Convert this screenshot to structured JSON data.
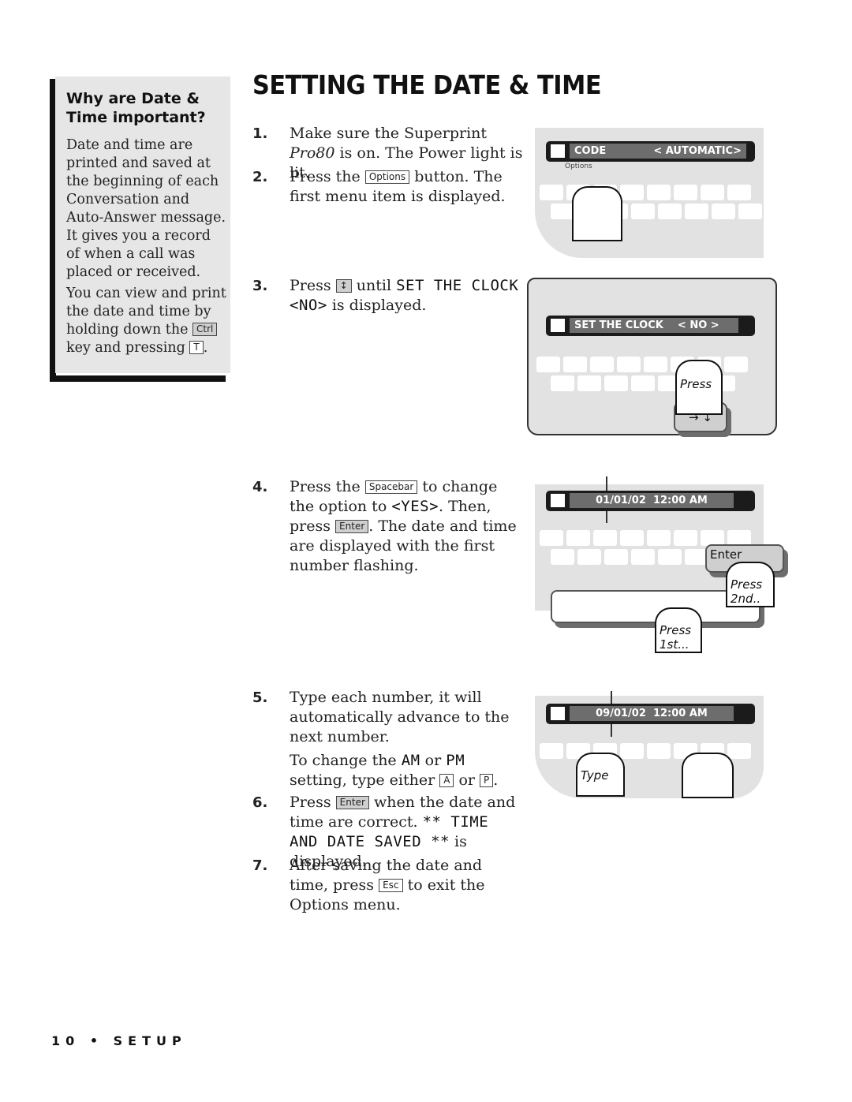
{
  "sidebar": {
    "title": "Why are Date & Time important?",
    "para1": "Date and time are printed and saved at the beginning of each Conversation and Auto-Answer message. It gives you a record of when a call was placed or received.",
    "para2_before": "You can view and print the date and time by holding down the",
    "para2_key1": "Ctrl",
    "para2_mid": "key and pressing",
    "para2_key2": "T",
    "para2_end": "."
  },
  "page_title": "SETTING THE DATE & TIME",
  "steps": [
    {
      "num": "1.",
      "text_a": "Make sure the Superprint ",
      "text_em": "Pro80",
      "text_b": " is on. The Power light is lit."
    },
    {
      "num": "2.",
      "text_a": "Press the",
      "key": "Options",
      "text_b": "button. The first menu item is displayed."
    },
    {
      "num": "3.",
      "text_a": "Press",
      "key": "↕",
      "text_b": "until",
      "lcd": "SET THE CLOCK <NO>",
      "text_c": "is displayed."
    },
    {
      "num": "4.",
      "text_a": "Press the",
      "key": "Spacebar",
      "text_b": "to change the option to",
      "lcd": "<YES>",
      "text_c": ". Then, press",
      "key2": "Enter",
      "text_d": ". The date and time are displayed with the first number flashing."
    },
    {
      "num": "5.",
      "text_a": "Type each number, it will automatically advance to the next number.",
      "text_b": "To change the",
      "lcd1": "AM",
      "text_c": "or",
      "lcd2": "PM",
      "text_d": "setting, type either",
      "key1": "A",
      "text_e": "or",
      "key2": "P",
      "text_f": "."
    },
    {
      "num": "6.",
      "text_a": "Press",
      "key": "Enter",
      "text_b": "when the date and time are correct.",
      "lcd": "** TIME AND DATE SAVED **",
      "text_c": "is displayed."
    },
    {
      "num": "7.",
      "text_a": "After saving the date and time, press",
      "key": "Esc",
      "text_b": "to exit the Options menu."
    }
  ],
  "illustrations": [
    {
      "display_left": "CODE",
      "display_right": "< AUTOMATIC>",
      "label": "Options"
    },
    {
      "display": "SET THE CLOCK    < NO >",
      "hand_label": "Press",
      "key": "→ ↓"
    },
    {
      "display": "01/01/02  12:00 AM",
      "key_label": "Enter",
      "hand1_label": "Press 1st...",
      "hand2_label": "Press 2nd.."
    },
    {
      "display": "09/01/02  12:00 AM",
      "hand_label": "Type"
    }
  ],
  "footer": "10 • SETUP"
}
